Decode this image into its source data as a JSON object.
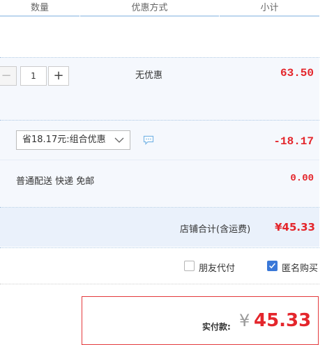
{
  "header": {
    "col_quantity": "数量",
    "col_discount": "优惠方式",
    "col_subtotal": "小计"
  },
  "item": {
    "quantity": "1",
    "minus_label": "−",
    "plus_label": "+",
    "discount_text": "无优惠",
    "subtotal": "63.50"
  },
  "discount": {
    "selected": "省18.17元:组合优惠",
    "amount": "-18.17",
    "icon": "chat-bubble-icon"
  },
  "shipping": {
    "text": "普通配送 快递 免邮",
    "amount": "0.00"
  },
  "shop_total": {
    "label": "店铺合计(含运费)",
    "amount": "¥45.33"
  },
  "options": {
    "friend_pay": {
      "label": "朋友代付",
      "checked": false
    },
    "anonymous": {
      "label": "匿名购买",
      "checked": true
    }
  },
  "payment": {
    "label": "实付款:",
    "currency": "¥",
    "amount": "45.33"
  },
  "colors": {
    "accent_red": "#e4262c",
    "header_line": "#bcd6ee",
    "row_bg": "#f5f8fd",
    "checkbox_blue": "#3a78d8"
  }
}
